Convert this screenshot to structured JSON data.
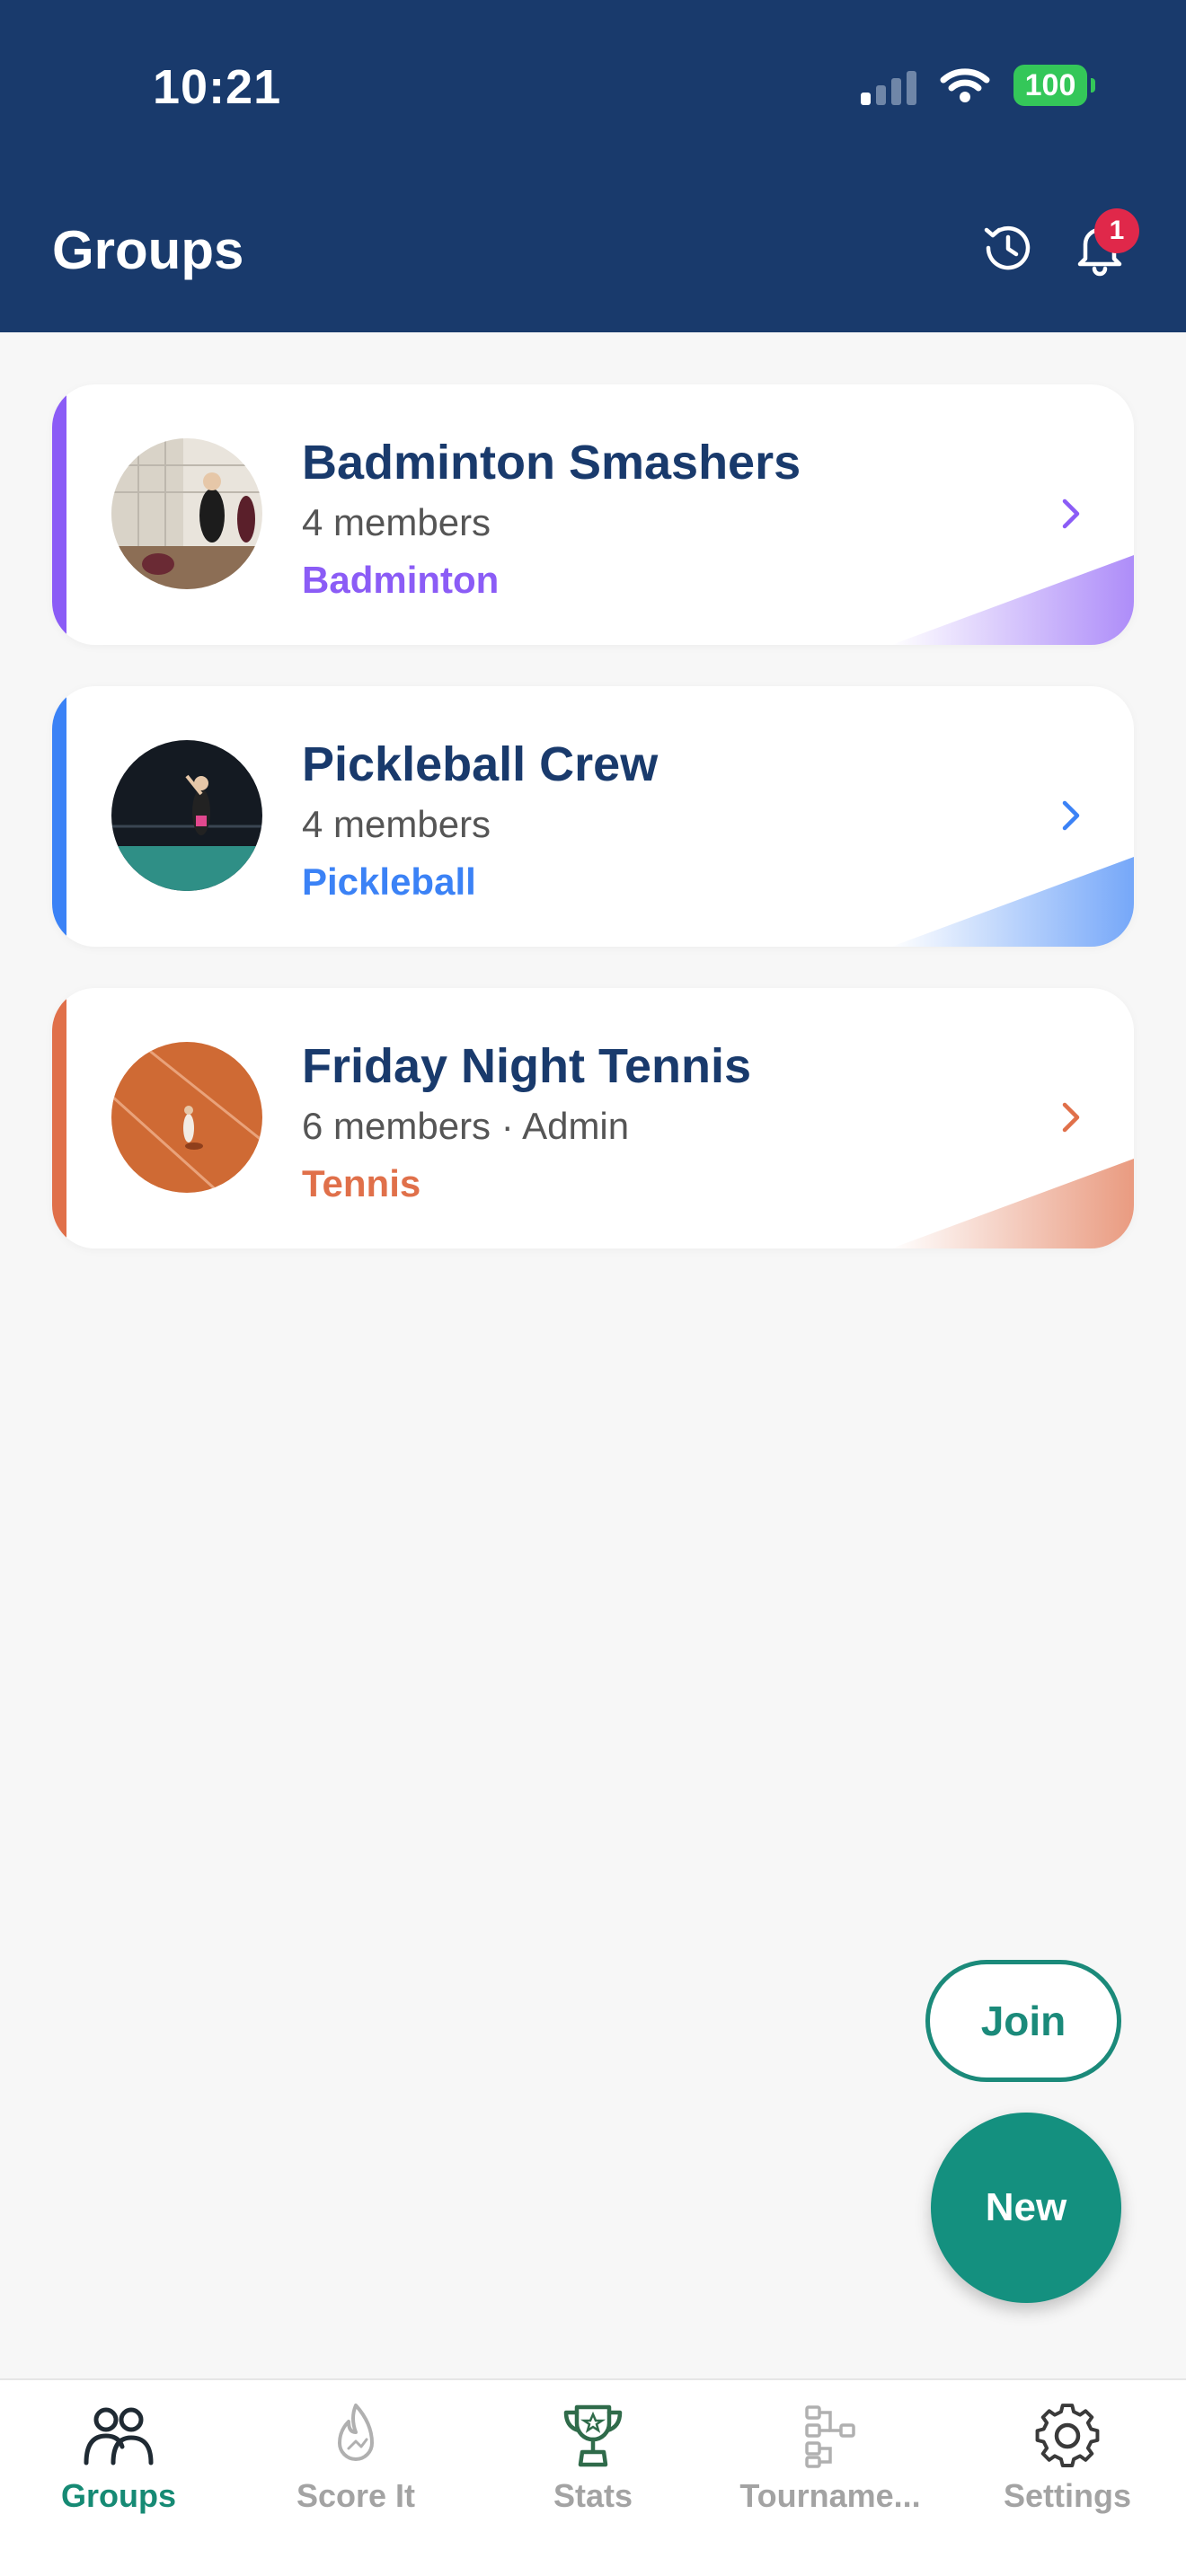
{
  "status_bar": {
    "time": "10:21",
    "battery": "100"
  },
  "header": {
    "title": "Groups",
    "notification_count": "1"
  },
  "groups": [
    {
      "name": "Badminton Smashers",
      "members": "4 members",
      "sport": "Badminton",
      "color": "#8b5cf6"
    },
    {
      "name": "Pickleball Crew",
      "members": "4 members",
      "sport": "Pickleball",
      "color": "#3b82f6"
    },
    {
      "name": "Friday Night Tennis",
      "members": "6 members · Admin",
      "sport": "Tennis",
      "color": "#e0704a"
    }
  ],
  "actions": {
    "join_label": "Join",
    "new_label": "New"
  },
  "tabs": [
    {
      "label": "Groups",
      "icon": "people-icon",
      "active": true
    },
    {
      "label": "Score It",
      "icon": "flame-icon",
      "active": false
    },
    {
      "label": "Stats",
      "icon": "trophy-icon",
      "active": false
    },
    {
      "label": "Tourname...",
      "icon": "bracket-icon",
      "active": false
    },
    {
      "label": "Settings",
      "icon": "gear-icon",
      "active": false
    }
  ]
}
